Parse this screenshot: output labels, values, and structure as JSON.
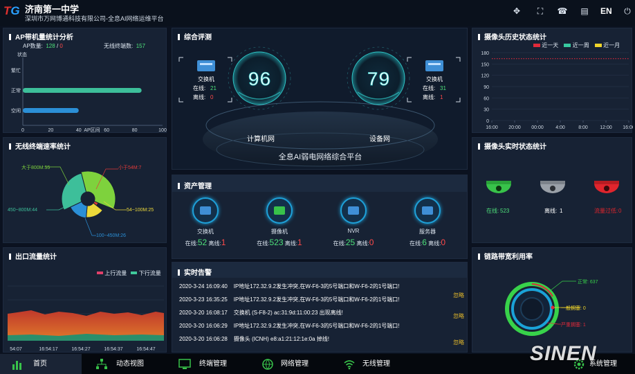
{
  "header": {
    "title": "济南第一中学",
    "subtitle": "深圳市万网博通科技有限公司-全息AI网络运维平台",
    "lang": "EN"
  },
  "ap": {
    "title": "AP带机量统计分析",
    "ap_label": "AP数量:",
    "ap_online": "128",
    "ap_sep": "/",
    "ap_offline": "0",
    "term_label": "无线终端数:",
    "term_count": "157",
    "ylabel": "状态",
    "xlabel": "AP区间"
  },
  "rate": {
    "title": "无线终端速率统计",
    "l1": "大于800M:55",
    "l2": "小于54M:7",
    "l3": "54~100M:25",
    "l4": "100~450M:26",
    "l5": "450~800M:44"
  },
  "flow": {
    "title": "出口流量统计",
    "up": "上行流量",
    "down": "下行流量"
  },
  "overview": {
    "title": "综合评测",
    "score1": "96",
    "score2": "79",
    "sw_left": "交换机",
    "sw_left_online_label": "在线:",
    "sw_left_online": "21",
    "sw_left_offline_label": "离线:",
    "sw_left_offline": "0",
    "sw_right": "交换机",
    "sw_right_online_label": "在线:",
    "sw_right_online": "31",
    "sw_right_offline_label": "离线:",
    "sw_right_offline": "1",
    "net1": "计算机网",
    "net2": "设备网",
    "platform": "全息AI弱电网络综合平台"
  },
  "assets": {
    "title": "资产管理",
    "items": [
      {
        "name": "交换机",
        "on_label": "在线:",
        "on": "52",
        "off_label": "离线:",
        "off": "1"
      },
      {
        "name": "摄像机",
        "on_label": "在线:",
        "on": "523",
        "off_label": "离线:",
        "off": "1"
      },
      {
        "name": "NVR",
        "on_label": "在线:",
        "on": "25",
        "off_label": "离线:",
        "off": "0"
      },
      {
        "name": "服务器",
        "on_label": "在线:",
        "on": "6",
        "off_label": "离线:",
        "off": "0"
      }
    ]
  },
  "alarms": {
    "title": "实时告警",
    "rows": [
      {
        "time": "2020-3-24 16:09:40",
        "msg": "IP地址172.32.9.2发生冲突,在W-F6-3的5号端口和W-F6-2的1号端口!",
        "ack": ""
      },
      {
        "time": "2020-3-23 16:35:25",
        "msg": "IP地址172.32.9.2发生冲突,在W-F6-3的5号端口和W-F6-2的1号端口!",
        "ack": "忽略"
      },
      {
        "time": "2020-3-20 16:08:17",
        "msg": "交换机 (S-F8-2) ac:31:9d:11:00:23 出现离线!",
        "ack": "忽略"
      },
      {
        "time": "2020-3-20 16:06:29",
        "msg": "IP地址172.32.9.2发生冲突,在W-F6-3的5号端口和W-F6-2的1号端口!",
        "ack": ""
      },
      {
        "time": "2020-3-20 16:06:28",
        "msg": "摄像头 (ICNH) e8:a1:21:12:1e:0a 掉线!",
        "ack": "忽略"
      }
    ]
  },
  "cam_hist": {
    "title": "摄像头历史状态统计",
    "legend": [
      "近一天",
      "近一周",
      "近一月"
    ]
  },
  "cam_rt": {
    "title": "摄像头实时状态统计",
    "online_label": "在线:",
    "online": "523",
    "offline_label": "离线:",
    "offline": "1",
    "flow_label": "流量过低:",
    "flow": "0"
  },
  "link": {
    "title": "链路带宽利用率",
    "normal": "正常: 637",
    "warn": "一般拥塞: 0",
    "severe": "严重拥塞: 1"
  },
  "footer": {
    "items": [
      "首页",
      "动态视图",
      "终端管理",
      "网络管理",
      "无线管理",
      "系统管理"
    ]
  },
  "watermark": "SINEN",
  "chart_data": [
    {
      "type": "bar",
      "orientation": "horizontal",
      "title": "AP带机量统计分析",
      "ylabel": "状态",
      "xlabel": "AP区间",
      "categories": [
        "繁忙",
        "正常",
        "空闲"
      ],
      "values": [
        0,
        85,
        40
      ],
      "xlim": [
        0,
        100
      ],
      "xticks": [
        "0",
        "20",
        "40",
        "60",
        "80",
        "100"
      ]
    },
    {
      "type": "pie",
      "title": "无线终端速率统计",
      "categories": [
        "大于800M",
        "小于54M",
        "54~100M",
        "100~450M",
        "450~800M"
      ],
      "values": [
        55,
        7,
        25,
        26,
        44
      ]
    },
    {
      "type": "area",
      "title": "出口流量统计",
      "xticks": [
        "54:07",
        "16:54:17",
        "16:54:27",
        "16:54:37",
        "16:54:47"
      ],
      "series": [
        {
          "name": "上行流量"
        },
        {
          "name": "下行流量"
        }
      ]
    },
    {
      "type": "line",
      "title": "摄像头历史状态统计",
      "ylim": [
        0,
        180
      ],
      "yticks": [
        "0",
        "30",
        "60",
        "90",
        "120",
        "150",
        "180"
      ],
      "xticks": [
        "16:00",
        "20:00",
        "00:00",
        "4:00",
        "8:00",
        "12:00",
        "16:00"
      ],
      "series": [
        {
          "name": "近一天",
          "value": 164
        },
        {
          "name": "近一周"
        },
        {
          "name": "近一月"
        }
      ]
    }
  ]
}
